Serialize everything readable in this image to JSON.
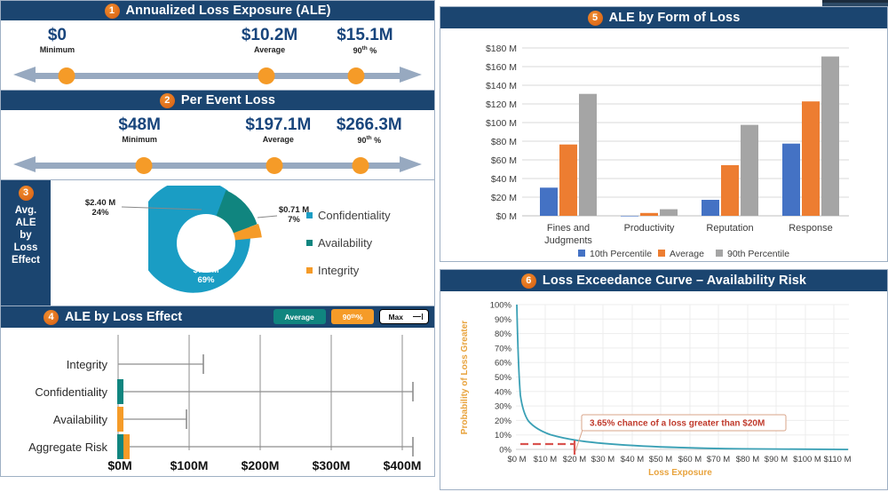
{
  "panel1": {
    "number": "1",
    "title": "Annualized Loss Exposure (ALE)",
    "stats": [
      {
        "value": "$0",
        "label": "Minimum",
        "pos": 13
      },
      {
        "value": "$10.2M",
        "label": "Average",
        "pos": 62
      },
      {
        "value": "$15.1M",
        "label": "90th %",
        "pos": 84
      }
    ]
  },
  "panel2": {
    "number": "2",
    "title": "Per Event Loss",
    "stats": [
      {
        "value": "$48M",
        "label": "Minimum",
        "pos": 32
      },
      {
        "value": "$197.1M",
        "label": "Average",
        "pos": 64
      },
      {
        "value": "$266.3M",
        "label": "90th %",
        "pos": 85
      }
    ]
  },
  "panel3": {
    "number": "3",
    "side_title": "Avg. ALE by Loss Effect",
    "labels": {
      "availability": {
        "value": "$2.40 M",
        "pct": "24%"
      },
      "integrity": {
        "value": "$0.71 M",
        "pct": "7%"
      },
      "confidentiality": {
        "value": "$7.0 M",
        "pct": "69%"
      }
    },
    "legend": [
      {
        "label": "Confidentiality",
        "color": "#1a9dc4"
      },
      {
        "label": "Availability",
        "color": "#10857f"
      },
      {
        "label": "Integrity",
        "color": "#f59b28"
      }
    ],
    "chart_data": {
      "type": "pie",
      "title": "Avg. ALE by Loss Effect",
      "categories": [
        "Confidentiality",
        "Availability",
        "Integrity"
      ],
      "values": [
        7.0,
        2.4,
        0.71
      ],
      "percentages": [
        69,
        24,
        7
      ],
      "value_labels": [
        "$7.0 M",
        "$2.40 M",
        "$0.71 M"
      ],
      "colors": [
        "#1a9dc4",
        "#10857f",
        "#f59b28"
      ],
      "legend_position": "right"
    }
  },
  "panel4": {
    "number": "4",
    "title": "ALE by Loss Effect",
    "controls": [
      {
        "label": "Average",
        "kind": "avg"
      },
      {
        "label": "90th %",
        "kind": "p90"
      },
      {
        "label": "Max",
        "kind": "max"
      }
    ],
    "chart_data": {
      "type": "bar",
      "orientation": "horizontal",
      "title": "ALE by Loss Effect",
      "categories": [
        "Integrity",
        "Confidentiality",
        "Availability",
        "Aggregate Risk"
      ],
      "xlabel": "",
      "ylabel": "",
      "xlim": [
        0,
        440
      ],
      "xticks": [
        0,
        100,
        200,
        300,
        400
      ],
      "xtick_labels": [
        "$0M",
        "$100M",
        "$200M",
        "$300M",
        "$400M"
      ],
      "grid": true,
      "series": [
        {
          "name": "Average",
          "values": [
            1,
            8,
            1,
            8
          ]
        },
        {
          "name": "90th %",
          "values": [
            1,
            1,
            7,
            6
          ]
        },
        {
          "name": "Max",
          "values": [
            170,
            430,
            96,
            430
          ]
        }
      ]
    }
  },
  "panel5": {
    "number": "5",
    "title": "ALE by Form of Loss",
    "chart_data": {
      "type": "bar",
      "title": "ALE by Form of Loss",
      "categories": [
        "Fines and Judgments",
        "Productivity",
        "Reputation",
        "Response"
      ],
      "xlabel": "",
      "ylabel": "",
      "ylim": [
        0,
        180
      ],
      "yticks": [
        0,
        20,
        40,
        60,
        80,
        100,
        120,
        140,
        160,
        180
      ],
      "ytick_labels": [
        "$0 M",
        "$20 M",
        "$40 M",
        "$60 M",
        "$80 M",
        "$100 M",
        "$120 M",
        "$140 M",
        "$160 M",
        "$180 M"
      ],
      "grid": true,
      "legend_position": "bottom",
      "series": [
        {
          "name": "10th Percentile",
          "values": [
            30,
            0,
            17,
            77
          ],
          "color": "#4472c4"
        },
        {
          "name": "Average",
          "values": [
            76,
            3,
            54,
            122
          ],
          "color": "#ed7d31"
        },
        {
          "name": "90th Percentile",
          "values": [
            130,
            7,
            97,
            170
          ],
          "color": "#a5a5a5"
        }
      ]
    }
  },
  "panel6": {
    "number": "6",
    "title": "Loss Exceedance Curve – Availability Risk",
    "annotation": "3.65% chance of a loss greater than $20M",
    "chart_data": {
      "type": "line",
      "title": "Loss Exceedance Curve – Availability Risk",
      "xlabel": "Loss Exposure",
      "ylabel": "Probability of Loss Greater",
      "xlim": [
        0,
        115
      ],
      "ylim": [
        0,
        100
      ],
      "xticks": [
        0,
        10,
        20,
        30,
        40,
        50,
        60,
        70,
        80,
        90,
        100,
        110
      ],
      "xtick_labels": [
        "$0 M",
        "$10 M",
        "$20 M",
        "$30 M",
        "$40 M",
        "$50 M",
        "$60 M",
        "$70 M",
        "$80 M",
        "$90 M",
        "$100 M",
        "$110 M"
      ],
      "yticks": [
        0,
        10,
        20,
        30,
        40,
        50,
        60,
        70,
        80,
        90,
        100
      ],
      "ytick_labels": [
        "0%",
        "10%",
        "20%",
        "30%",
        "40%",
        "50%",
        "60%",
        "70%",
        "80%",
        "90%",
        "100%"
      ],
      "grid": true,
      "line_color": "#3aa0b5",
      "annotation_value": 3.65,
      "annotation_x": 20,
      "series": [
        {
          "name": "Exceedance",
          "x": [
            0.3,
            0.6,
            1.0,
            1.5,
            2.0,
            2.6,
            3.2,
            4.0,
            5.0,
            6.5,
            8,
            10,
            13,
            16,
            20,
            25,
            30,
            38,
            46,
            56,
            68,
            80,
            95,
            112
          ],
          "y": [
            100,
            72,
            46,
            32,
            24,
            19.5,
            17,
            15.2,
            13.6,
            12.0,
            10.8,
            9.6,
            8.1,
            6.9,
            5.2,
            4.0,
            3.2,
            2.4,
            1.9,
            1.4,
            1.0,
            0.7,
            0.4,
            0.2
          ]
        }
      ]
    }
  }
}
